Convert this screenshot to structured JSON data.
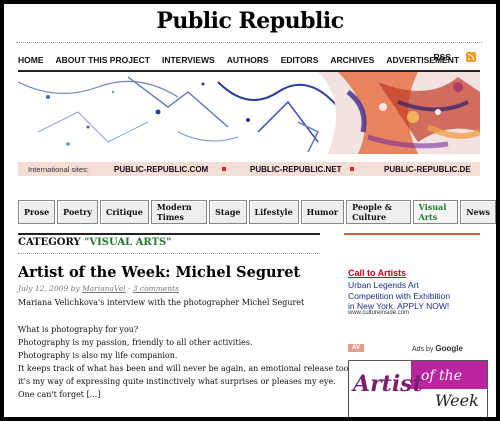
{
  "site": {
    "title": "Public Republic"
  },
  "nav": {
    "items": [
      "HOME",
      "ABOUT THIS PROJECT",
      "INTERVIEWS",
      "AUTHORS",
      "EDITORS",
      "ARCHIVES",
      "ADVERTISEMENT"
    ],
    "rss_label": "RSS",
    "rss_icon": "rss-icon"
  },
  "international": {
    "label": "International sites:",
    "sites": [
      "PUBLIC-REPUBLIC.COM",
      "PUBLIC-REPUBLIC.NET",
      "PUBLIC-REPUBLIC.DE"
    ]
  },
  "tabs": {
    "items": [
      "Prose",
      "Poetry",
      "Critique",
      "Modern Times",
      "Stage",
      "Lifestyle",
      "Humor",
      "People & Culture",
      "Visual Arts",
      "News"
    ],
    "active": "Visual Arts"
  },
  "category": {
    "prefix": "CATEGORY",
    "name": "\"VISUAL ARTS\""
  },
  "post": {
    "title": "Artist of the Week: Michel Seguret",
    "date": "July 12, 2009 by",
    "author": "MarianaVel",
    "separator": "·",
    "comments": "3 comments",
    "lines": [
      "Mariana Velichkova's interview with the photographer Michel Seguret",
      "",
      "What is photography for you?",
      "Photography is my passion, friendly to all other activities.",
      "Photography is also my life companion.",
      "It keeps track of what has been and will never be again, an emotional release too,",
      "it's my way of expressing quite instinctively what surprises or pleases my eye.",
      "One can't forget [...]"
    ]
  },
  "sidebar": {
    "cta_title": "Call to Artists",
    "cta_lines": [
      "Urban Legends Art",
      "Competition with Exhibition",
      "in New York. APPLY NOW!"
    ],
    "cta_url": "www.cultureinside.com",
    "av_label": "AV",
    "ads_by": "Ads by",
    "ads_brand": "Google",
    "ad_banner": {
      "artist": "Artist",
      "of_the": "of the",
      "week": "Week"
    }
  },
  "colors": {
    "accent_green": "#1d7a2a",
    "cta_red": "#c0001a",
    "link_blue": "#1a2f8a",
    "rss_orange": "#f39a1e",
    "intl_bar": "#f2ddd7"
  }
}
